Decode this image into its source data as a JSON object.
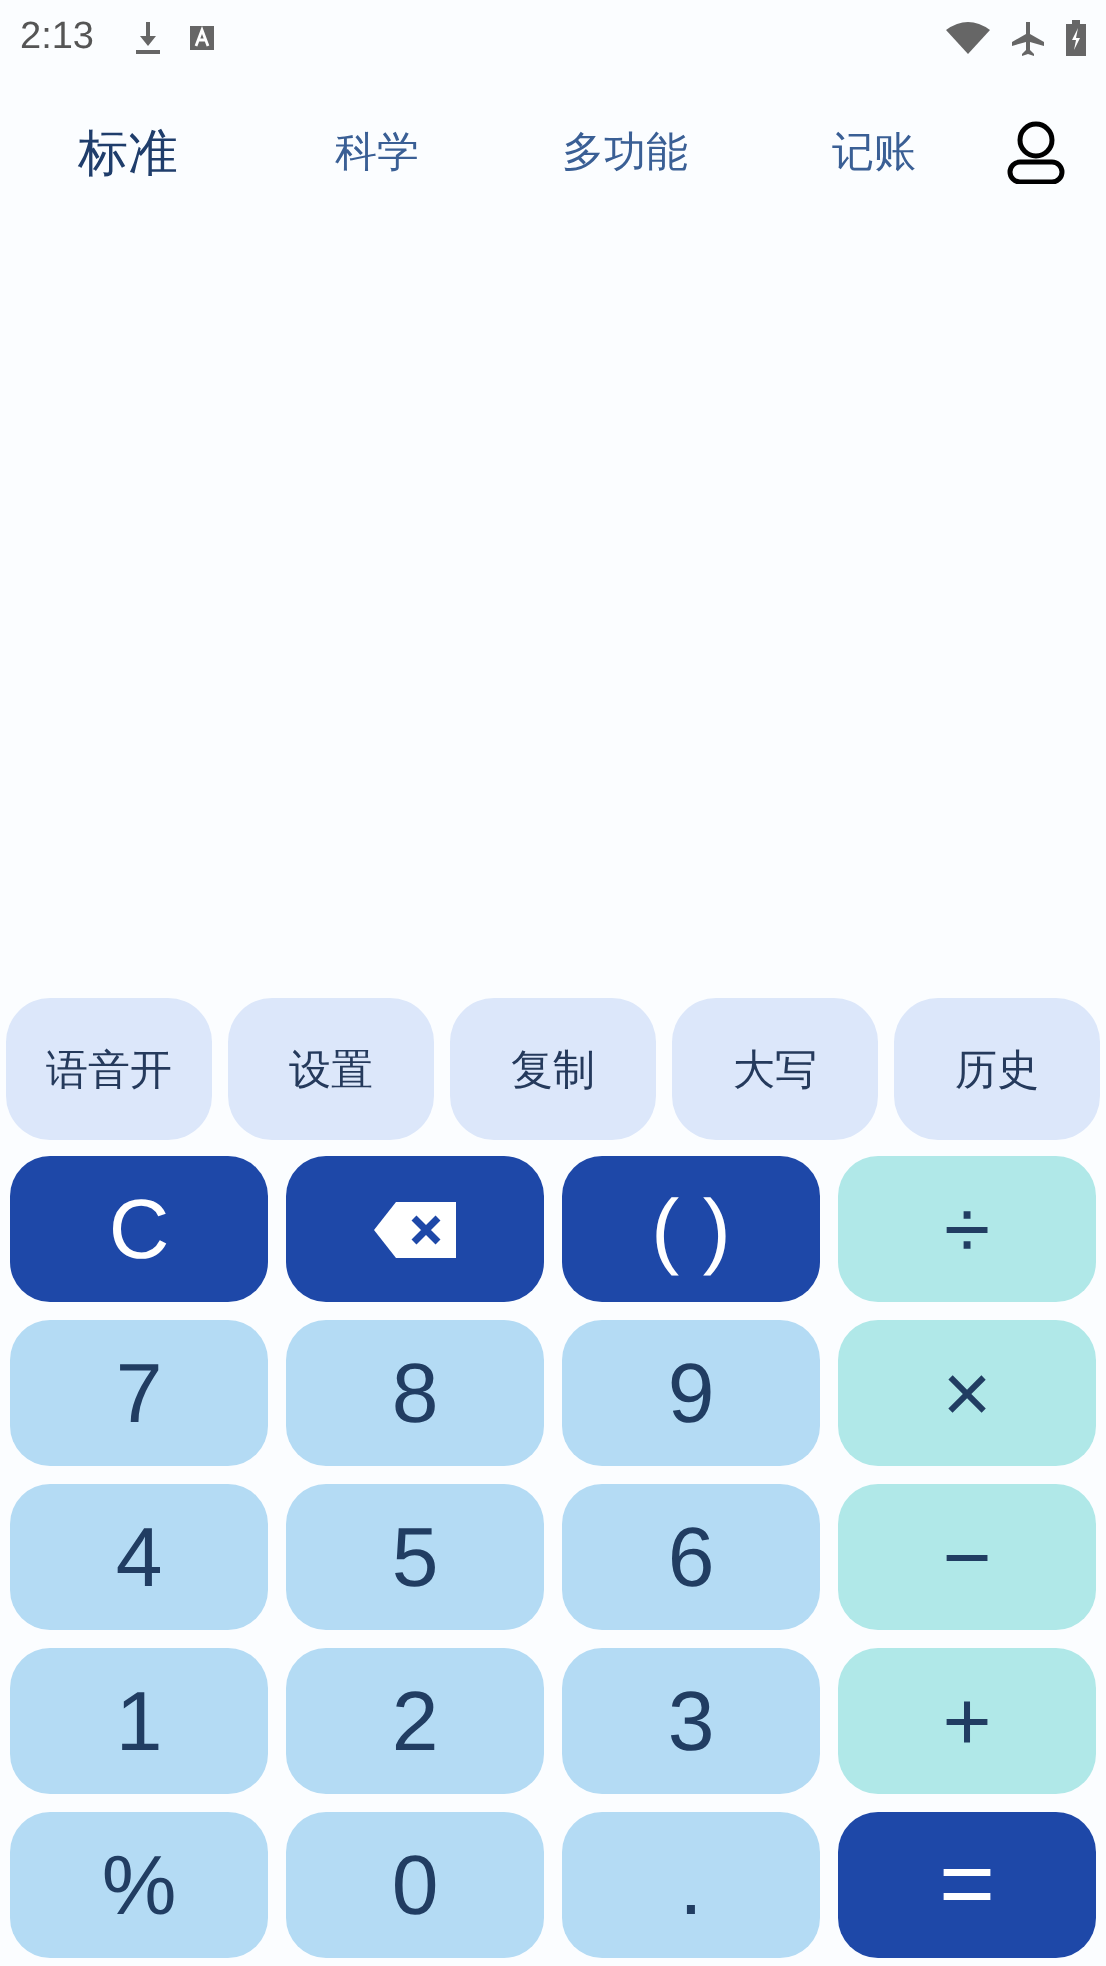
{
  "status_bar": {
    "time": "2:13"
  },
  "tabs": [
    {
      "label": "标准",
      "selected": true
    },
    {
      "label": "科学",
      "selected": false
    },
    {
      "label": "多功能",
      "selected": false
    },
    {
      "label": "记账",
      "selected": false
    }
  ],
  "function_buttons": [
    "语音开",
    "设置",
    "复制",
    "大写",
    "历史"
  ],
  "keys": [
    {
      "kind": "clear",
      "label": "C"
    },
    {
      "kind": "backspace"
    },
    {
      "kind": "clear",
      "label": "( )"
    },
    {
      "kind": "operator",
      "label": "÷"
    },
    {
      "kind": "digit",
      "label": "7"
    },
    {
      "kind": "digit",
      "label": "8"
    },
    {
      "kind": "digit",
      "label": "9"
    },
    {
      "kind": "operator",
      "label": "×"
    },
    {
      "kind": "digit",
      "label": "4"
    },
    {
      "kind": "digit",
      "label": "5"
    },
    {
      "kind": "digit",
      "label": "6"
    },
    {
      "kind": "operator",
      "label": "−"
    },
    {
      "kind": "digit",
      "label": "1"
    },
    {
      "kind": "digit",
      "label": "2"
    },
    {
      "kind": "digit",
      "label": "3"
    },
    {
      "kind": "operator",
      "label": "+"
    },
    {
      "kind": "digit",
      "label": "%"
    },
    {
      "kind": "digit",
      "label": "0"
    },
    {
      "kind": "digit",
      "label": "."
    },
    {
      "kind": "equals",
      "label": "="
    }
  ]
}
